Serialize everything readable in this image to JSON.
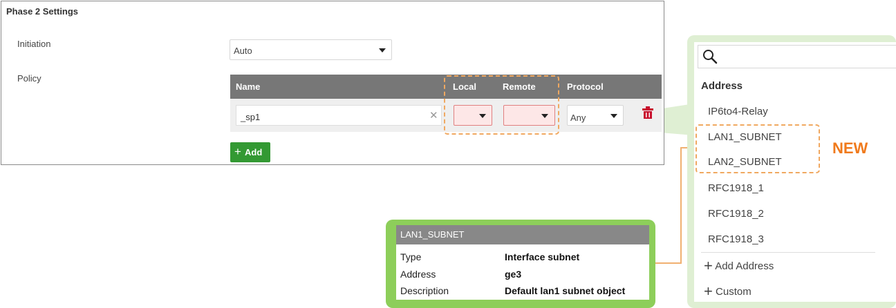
{
  "panel": {
    "title": "Phase 2 Settings",
    "initiation_label": "Initiation",
    "initiation_value": "Auto",
    "policy_label": "Policy",
    "columns": {
      "name": "Name",
      "local": "Local",
      "remote": "Remote",
      "protocol": "Protocol"
    },
    "row": {
      "name_value": "_sp1",
      "protocol_value": "Any"
    },
    "add_label": "Add"
  },
  "dropdown": {
    "section": "Address",
    "items": [
      "IP6to4-Relay",
      "LAN1_SUBNET",
      "LAN2_SUBNET",
      "RFC1918_1",
      "RFC1918_2",
      "RFC1918_3"
    ],
    "add_address": "Add Address",
    "custom": "Custom",
    "new_badge": "NEW"
  },
  "info_card": {
    "title": "LAN1_SUBNET",
    "rows": [
      {
        "key": "Type",
        "value": "Interface subnet"
      },
      {
        "key": "Address",
        "value": "ge3"
      },
      {
        "key": "Description",
        "value": "Default lan1 subnet object"
      }
    ]
  },
  "colors": {
    "accent_orange": "#f07a1c",
    "callout_green": "#dfefd3",
    "card_green": "#8dce5a",
    "add_button": "#339933",
    "header_gray": "#777777",
    "delete_red": "#c8102e"
  }
}
